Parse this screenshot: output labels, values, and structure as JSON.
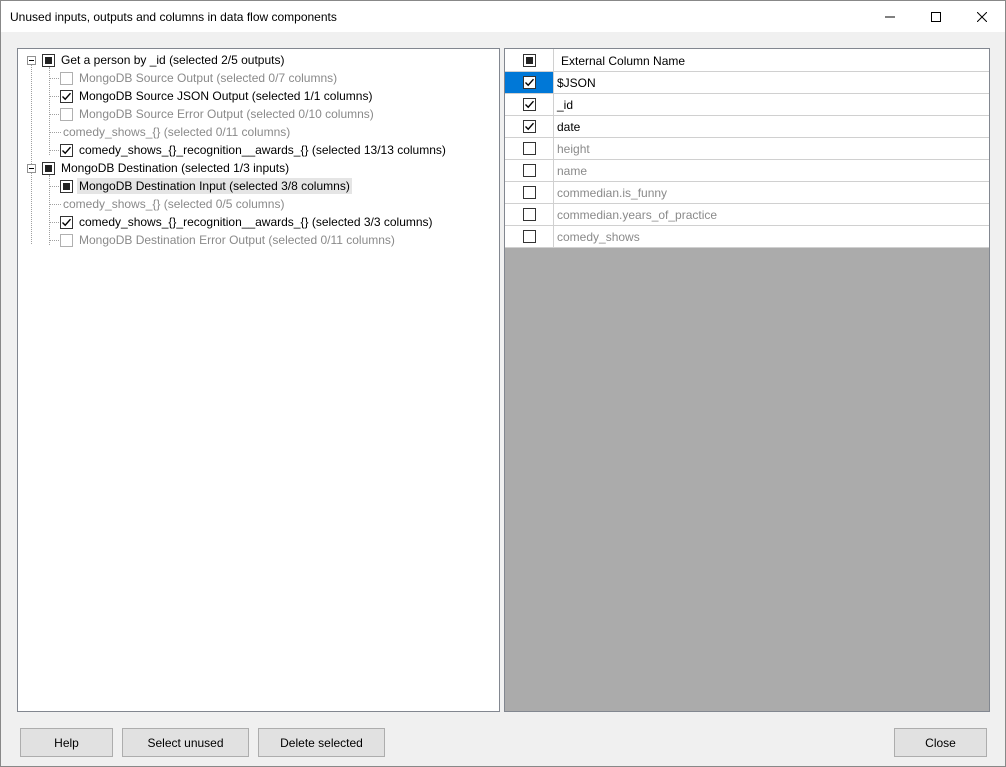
{
  "window": {
    "title": "Unused inputs, outputs and columns in data flow components",
    "minimize_icon": "minimize-icon",
    "maximize_icon": "maximize-icon",
    "close_icon": "close-icon"
  },
  "tree": {
    "nodes": [
      {
        "label": "Get a person by _id (selected 2/5 outputs)",
        "check": "partial",
        "level": 0,
        "expander": true,
        "enabled": true
      },
      {
        "label": "MongoDB Source Output (selected 0/7 columns)",
        "check": "unchecked",
        "level": 1,
        "enabled": false
      },
      {
        "label": "MongoDB Source JSON Output (selected 1/1 columns)",
        "check": "checked",
        "level": 1,
        "enabled": true
      },
      {
        "label": "MongoDB Source Error Output (selected 0/10 columns)",
        "check": "unchecked",
        "level": 1,
        "enabled": false
      },
      {
        "label": "comedy_shows_{} (selected 0/11 columns)",
        "check": "none",
        "level": 1,
        "enabled": false
      },
      {
        "label": "comedy_shows_{}_recognition__awards_{} (selected 13/13 columns)",
        "check": "checked",
        "level": 1,
        "enabled": true
      },
      {
        "label": "MongoDB Destination (selected 1/3 inputs)",
        "check": "partial",
        "level": 0,
        "expander": true,
        "enabled": true
      },
      {
        "label": "MongoDB Destination Input (selected 3/8 columns)",
        "check": "partial",
        "level": 1,
        "enabled": true,
        "selected": true
      },
      {
        "label": "comedy_shows_{} (selected 0/5 columns)",
        "check": "none",
        "level": 1,
        "enabled": false
      },
      {
        "label": "comedy_shows_{}_recognition__awards_{} (selected 3/3 columns)",
        "check": "checked",
        "level": 1,
        "enabled": true
      },
      {
        "label": "MongoDB Destination Error Output (selected 0/11 columns)",
        "check": "unchecked",
        "level": 1,
        "enabled": false
      }
    ]
  },
  "grid": {
    "header": {
      "select_all": "partial",
      "column_name": "External Column Name"
    },
    "rows": [
      {
        "name": "$JSON",
        "checked": true,
        "enabled": true,
        "selected": true
      },
      {
        "name": "_id",
        "checked": true,
        "enabled": true
      },
      {
        "name": "date",
        "checked": true,
        "enabled": true
      },
      {
        "name": "height",
        "checked": false,
        "enabled": false
      },
      {
        "name": "name",
        "checked": false,
        "enabled": false
      },
      {
        "name": "commedian.is_funny",
        "checked": false,
        "enabled": false
      },
      {
        "name": "commedian.years_of_practice",
        "checked": false,
        "enabled": false
      },
      {
        "name": "comedy_shows",
        "checked": false,
        "enabled": false
      }
    ]
  },
  "buttons": {
    "help": "Help",
    "select_unused": "Select unused",
    "delete_selected": "Delete selected",
    "close": "Close"
  }
}
